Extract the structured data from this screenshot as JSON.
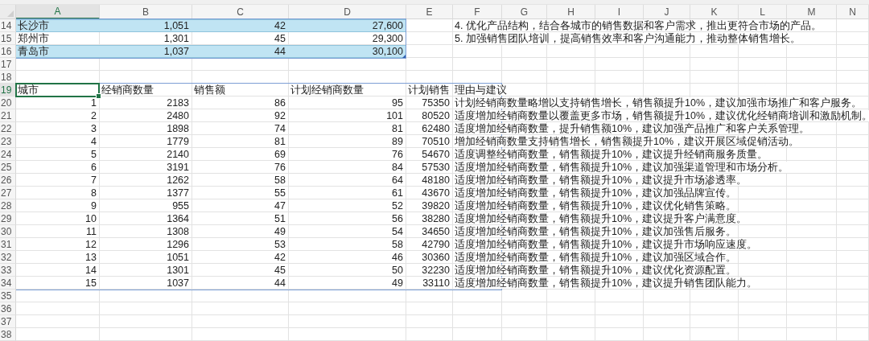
{
  "columns": [
    {
      "label": "A",
      "selected": true
    },
    {
      "label": "B",
      "selected": false
    },
    {
      "label": "C",
      "selected": false
    },
    {
      "label": "D",
      "selected": false
    },
    {
      "label": "E",
      "selected": false
    },
    {
      "label": "F",
      "selected": false
    },
    {
      "label": "G",
      "selected": false
    },
    {
      "label": "H",
      "selected": false
    },
    {
      "label": "I",
      "selected": false
    },
    {
      "label": "J",
      "selected": false
    },
    {
      "label": "K",
      "selected": false
    },
    {
      "label": "L",
      "selected": false
    },
    {
      "label": "M",
      "selected": false
    },
    {
      "label": "N",
      "selected": false
    }
  ],
  "sections": [
    {
      "kind": "table",
      "banded": true,
      "resize_handle": true,
      "rows": [
        {
          "number": "14",
          "selected": false,
          "cells": {
            "A": {
              "kind": "text",
              "text": "长沙市"
            },
            "B": {
              "kind": "number",
              "text": "1,051"
            },
            "C": {
              "kind": "number",
              "text": "42"
            },
            "D": {
              "kind": "number",
              "text": "27,600"
            }
          },
          "outside": {
            "F": {
              "kind": "text",
              "text": "4. 优化产品结构，结合各城市的销售数据和客户需求，推出更符合市场的产品。"
            }
          }
        },
        {
          "number": "15",
          "selected": false,
          "cells": {
            "A": {
              "kind": "text",
              "text": "郑州市"
            },
            "B": {
              "kind": "number",
              "text": "1,301"
            },
            "C": {
              "kind": "number",
              "text": "45"
            },
            "D": {
              "kind": "number",
              "text": "29,300"
            }
          },
          "outside": {
            "F": {
              "kind": "text",
              "text": "5. 加强销售团队培训，提高销售效率和客户沟通能力，推动整体销售增长。"
            }
          }
        },
        {
          "number": "16",
          "selected": false,
          "cells": {
            "A": {
              "kind": "text",
              "text": "青岛市"
            },
            "B": {
              "kind": "number",
              "text": "1,037"
            },
            "C": {
              "kind": "number",
              "text": "44"
            },
            "D": {
              "kind": "number",
              "text": "30,100"
            }
          }
        }
      ]
    },
    {
      "kind": "blank",
      "rows": [
        {
          "number": "17",
          "selected": false
        },
        {
          "number": "18",
          "selected": false
        }
      ]
    },
    {
      "kind": "table",
      "banded": false,
      "resize_handle": false,
      "rows": [
        {
          "number": "19",
          "selected": true,
          "cells": {
            "A": {
              "kind": "text",
              "text": "城市"
            },
            "B": {
              "kind": "text",
              "text": "经销商数量"
            },
            "C": {
              "kind": "text",
              "text": "销售额"
            },
            "D": {
              "kind": "text",
              "text": "计划经销商数量"
            },
            "E": {
              "kind": "text",
              "text": "计划销售"
            },
            "F": {
              "kind": "text",
              "text": "理由与建议"
            }
          }
        },
        {
          "number": "20",
          "selected": false,
          "cells": {
            "A": {
              "kind": "number",
              "text": "1"
            },
            "B": {
              "kind": "number",
              "text": "2183"
            },
            "C": {
              "kind": "number",
              "text": "86"
            },
            "D": {
              "kind": "number",
              "text": "95"
            },
            "E": {
              "kind": "number",
              "text": "75350"
            },
            "F": {
              "kind": "text",
              "text": "计划经销商数量略增以支持销售增长，销售额提升10%，建议加强市场推广和客户服务。"
            }
          }
        },
        {
          "number": "21",
          "selected": false,
          "cells": {
            "A": {
              "kind": "number",
              "text": "2"
            },
            "B": {
              "kind": "number",
              "text": "2480"
            },
            "C": {
              "kind": "number",
              "text": "92"
            },
            "D": {
              "kind": "number",
              "text": "101"
            },
            "E": {
              "kind": "number",
              "text": "80520"
            },
            "F": {
              "kind": "text",
              "text": "适度增加经销商数量以覆盖更多市场，销售额提升10%，建议优化经销商培训和激励机制。"
            }
          }
        },
        {
          "number": "22",
          "selected": false,
          "cells": {
            "A": {
              "kind": "number",
              "text": "3"
            },
            "B": {
              "kind": "number",
              "text": "1898"
            },
            "C": {
              "kind": "number",
              "text": "74"
            },
            "D": {
              "kind": "number",
              "text": "81"
            },
            "E": {
              "kind": "number",
              "text": "62480"
            },
            "F": {
              "kind": "text",
              "text": "适度增加经销商数量，提升销售额10%，建议加强产品推广和客户关系管理。"
            }
          }
        },
        {
          "number": "23",
          "selected": false,
          "cells": {
            "A": {
              "kind": "number",
              "text": "4"
            },
            "B": {
              "kind": "number",
              "text": "1779"
            },
            "C": {
              "kind": "number",
              "text": "81"
            },
            "D": {
              "kind": "number",
              "text": "89"
            },
            "E": {
              "kind": "number",
              "text": "70510"
            },
            "F": {
              "kind": "text",
              "text": "增加经销商数量支持销售增长，销售额提升10%，建议开展区域促销活动。"
            }
          }
        },
        {
          "number": "24",
          "selected": false,
          "cells": {
            "A": {
              "kind": "number",
              "text": "5"
            },
            "B": {
              "kind": "number",
              "text": "2140"
            },
            "C": {
              "kind": "number",
              "text": "69"
            },
            "D": {
              "kind": "number",
              "text": "76"
            },
            "E": {
              "kind": "number",
              "text": "54670"
            },
            "F": {
              "kind": "text",
              "text": "适度调整经销商数量，销售额提升10%，建议提升经销商服务质量。"
            }
          }
        },
        {
          "number": "25",
          "selected": false,
          "cells": {
            "A": {
              "kind": "number",
              "text": "6"
            },
            "B": {
              "kind": "number",
              "text": "3191"
            },
            "C": {
              "kind": "number",
              "text": "76"
            },
            "D": {
              "kind": "number",
              "text": "84"
            },
            "E": {
              "kind": "number",
              "text": "57530"
            },
            "F": {
              "kind": "text",
              "text": "适度增加经销商数量，销售额提升10%，建议加强渠道管理和市场分析。"
            }
          }
        },
        {
          "number": "26",
          "selected": false,
          "cells": {
            "A": {
              "kind": "number",
              "text": "7"
            },
            "B": {
              "kind": "number",
              "text": "1262"
            },
            "C": {
              "kind": "number",
              "text": "58"
            },
            "D": {
              "kind": "number",
              "text": "64"
            },
            "E": {
              "kind": "number",
              "text": "48180"
            },
            "F": {
              "kind": "text",
              "text": "适度增加经销商数量，销售额提升10%，建议提升市场渗透率。"
            }
          }
        },
        {
          "number": "27",
          "selected": false,
          "cells": {
            "A": {
              "kind": "number",
              "text": "8"
            },
            "B": {
              "kind": "number",
              "text": "1377"
            },
            "C": {
              "kind": "number",
              "text": "55"
            },
            "D": {
              "kind": "number",
              "text": "61"
            },
            "E": {
              "kind": "number",
              "text": "43670"
            },
            "F": {
              "kind": "text",
              "text": "适度增加经销商数量，销售额提升10%，建议加强品牌宣传。"
            }
          }
        },
        {
          "number": "28",
          "selected": false,
          "cells": {
            "A": {
              "kind": "number",
              "text": "9"
            },
            "B": {
              "kind": "number",
              "text": "955"
            },
            "C": {
              "kind": "number",
              "text": "47"
            },
            "D": {
              "kind": "number",
              "text": "52"
            },
            "E": {
              "kind": "number",
              "text": "39820"
            },
            "F": {
              "kind": "text",
              "text": "适度增加经销商数量，销售额提升10%，建议优化销售策略。"
            }
          }
        },
        {
          "number": "29",
          "selected": false,
          "cells": {
            "A": {
              "kind": "number",
              "text": "10"
            },
            "B": {
              "kind": "number",
              "text": "1364"
            },
            "C": {
              "kind": "number",
              "text": "51"
            },
            "D": {
              "kind": "number",
              "text": "56"
            },
            "E": {
              "kind": "number",
              "text": "38280"
            },
            "F": {
              "kind": "text",
              "text": "适度增加经销商数量，销售额提升10%，建议提升客户满意度。"
            }
          }
        },
        {
          "number": "30",
          "selected": false,
          "cells": {
            "A": {
              "kind": "number",
              "text": "11"
            },
            "B": {
              "kind": "number",
              "text": "1308"
            },
            "C": {
              "kind": "number",
              "text": "49"
            },
            "D": {
              "kind": "number",
              "text": "54"
            },
            "E": {
              "kind": "number",
              "text": "34650"
            },
            "F": {
              "kind": "text",
              "text": "适度增加经销商数量，销售额提升10%，建议加强售后服务。"
            }
          }
        },
        {
          "number": "31",
          "selected": false,
          "cells": {
            "A": {
              "kind": "number",
              "text": "12"
            },
            "B": {
              "kind": "number",
              "text": "1296"
            },
            "C": {
              "kind": "number",
              "text": "53"
            },
            "D": {
              "kind": "number",
              "text": "58"
            },
            "E": {
              "kind": "number",
              "text": "42790"
            },
            "F": {
              "kind": "text",
              "text": "适度增加经销商数量，销售额提升10%，建议提升市场响应速度。"
            }
          }
        },
        {
          "number": "32",
          "selected": false,
          "cells": {
            "A": {
              "kind": "number",
              "text": "13"
            },
            "B": {
              "kind": "number",
              "text": "1051"
            },
            "C": {
              "kind": "number",
              "text": "42"
            },
            "D": {
              "kind": "number",
              "text": "46"
            },
            "E": {
              "kind": "number",
              "text": "30360"
            },
            "F": {
              "kind": "text",
              "text": "适度增加经销商数量，销售额提升10%，建议加强区域合作。"
            }
          }
        },
        {
          "number": "33",
          "selected": false,
          "cells": {
            "A": {
              "kind": "number",
              "text": "14"
            },
            "B": {
              "kind": "number",
              "text": "1301"
            },
            "C": {
              "kind": "number",
              "text": "45"
            },
            "D": {
              "kind": "number",
              "text": "50"
            },
            "E": {
              "kind": "number",
              "text": "32230"
            },
            "F": {
              "kind": "text",
              "text": "适度增加经销商数量，销售额提升10%，建议优化资源配置。"
            }
          }
        },
        {
          "number": "34",
          "selected": false,
          "cells": {
            "A": {
              "kind": "number",
              "text": "15"
            },
            "B": {
              "kind": "number",
              "text": "1037"
            },
            "C": {
              "kind": "number",
              "text": "44"
            },
            "D": {
              "kind": "number",
              "text": "49"
            },
            "E": {
              "kind": "number",
              "text": "33110"
            },
            "F": {
              "kind": "text",
              "text": "适度增加经销商数量，销售额提升10%，建议提升销售团队能力。"
            }
          }
        }
      ]
    },
    {
      "kind": "blank",
      "rows": [
        {
          "number": "35",
          "selected": false
        },
        {
          "number": "36",
          "selected": false
        },
        {
          "number": "37",
          "selected": false
        },
        {
          "number": "38",
          "selected": false
        }
      ]
    }
  ]
}
